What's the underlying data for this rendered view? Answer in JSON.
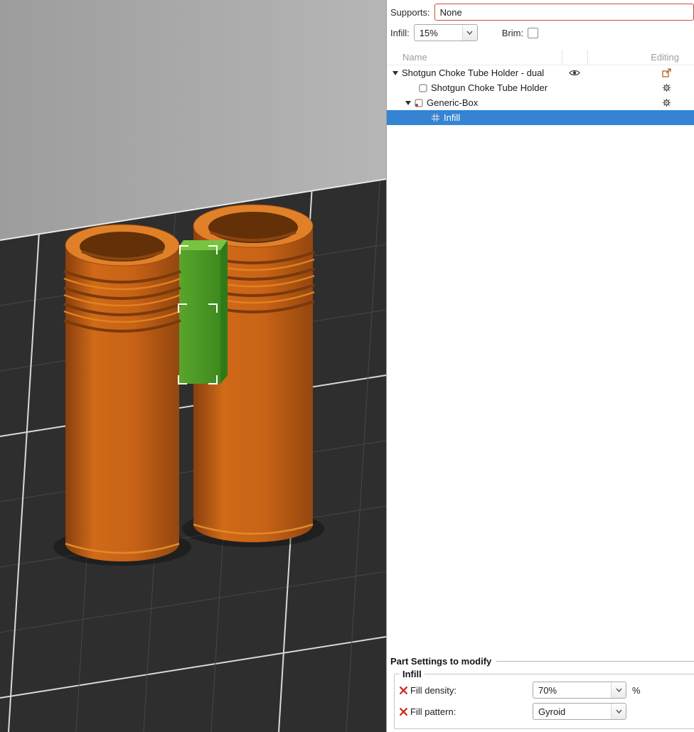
{
  "colors": {
    "selection_blue": "#3584d4",
    "model_orange": "#c9661a",
    "modifier_green": "#4f9f28",
    "attention_red": "#cc2b1d",
    "bed_dark": "#2e2e2e"
  },
  "panel": {
    "supports": {
      "label": "Supports:",
      "value": "None"
    },
    "infill": {
      "label": "Infill:",
      "value": "15%"
    },
    "brim": {
      "label": "Brim:"
    },
    "tree": {
      "header": {
        "name": "Name",
        "editing": "Editing"
      },
      "rows": [
        {
          "label": "Shotgun Choke Tube Holder - dual"
        },
        {
          "label": "Shotgun Choke Tube Holder"
        },
        {
          "label": "Generic-Box"
        },
        {
          "label": "Infill"
        }
      ]
    },
    "part_settings": {
      "title": "Part Settings to modify",
      "group_title": "Infill",
      "rows": [
        {
          "label": "Fill density:",
          "value": "70%",
          "suffix": "%"
        },
        {
          "label": "Fill pattern:",
          "value": "Gyroid",
          "suffix": ""
        }
      ]
    }
  }
}
